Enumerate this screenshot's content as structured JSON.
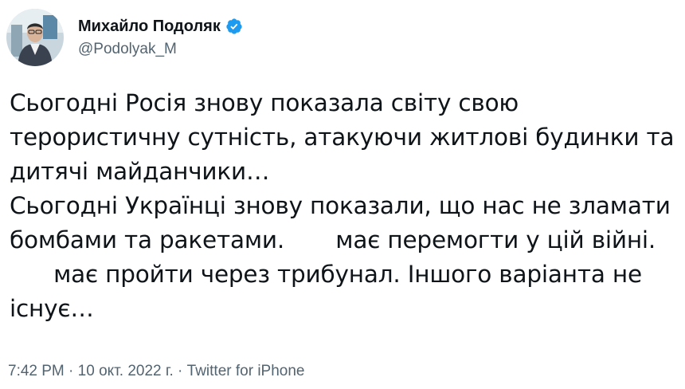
{
  "author": {
    "display_name": "Михайло Подоляк",
    "handle": "@Podolyak_M",
    "verified": true,
    "avatar_icon": "profile-photo"
  },
  "tweet": {
    "lines": [
      "Сьогодні Росія знову показала світу свою",
      "терористичну сутність, атакуючи житлові будинки та",
      "дитячі майданчики…",
      "Сьогодні Українці знову показали, що нас не зламати",
      "бомбами та ракетами.       має перемогти у цій війні.",
      "      має пройти через трибунал. Іншого варіанта не",
      "існує…"
    ]
  },
  "meta": {
    "time": "7:42 PM",
    "separator1": " · ",
    "date": "10 окт. 2022 г.",
    "separator2": " · ",
    "source": "Twitter for iPhone"
  },
  "colors": {
    "text": "#0f1419",
    "muted": "#536471",
    "verified": "#1d9bf0"
  }
}
